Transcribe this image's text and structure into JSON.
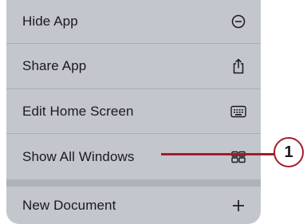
{
  "menu": {
    "items": [
      {
        "label": "Hide App",
        "icon": "minus-circle-icon"
      },
      {
        "label": "Share App",
        "icon": "share-icon"
      },
      {
        "label": "Edit Home Screen",
        "icon": "keyboard-icon"
      },
      {
        "label": "Show All Windows",
        "icon": "window-grid-icon"
      },
      {
        "label": "New Document",
        "icon": "plus-icon"
      }
    ]
  },
  "callout": {
    "number": "1"
  },
  "colors": {
    "menu_bg": "#c3c6cc",
    "callout": "#a31d2a",
    "text": "#1a1a1c"
  }
}
